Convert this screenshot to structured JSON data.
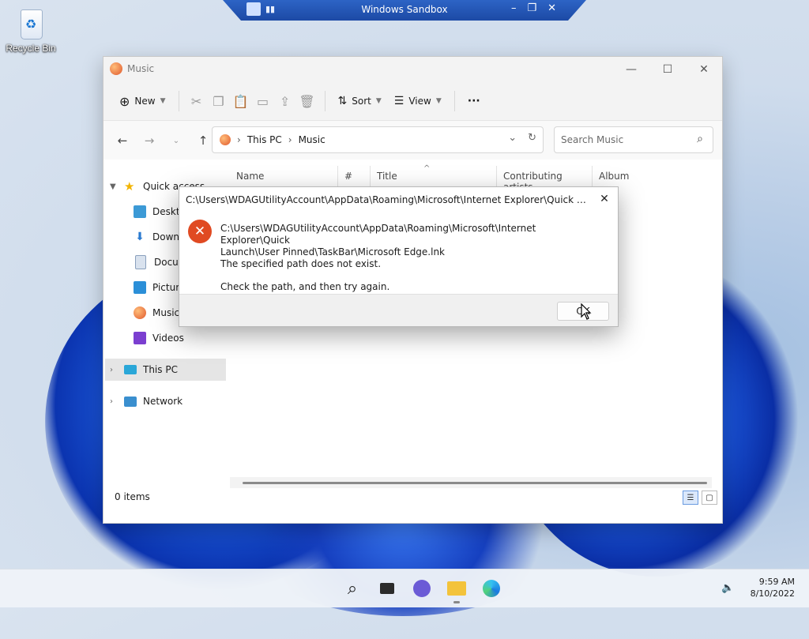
{
  "desktop": {
    "recycle_bin_label": "Recycle Bin"
  },
  "sandbox": {
    "title": "Windows Sandbox"
  },
  "explorer": {
    "title": "Music",
    "toolbar": {
      "new_label": "New",
      "sort_label": "Sort",
      "view_label": "View",
      "more_label": "···"
    },
    "address": {
      "crumbs": [
        "This PC",
        "Music"
      ]
    },
    "search_placeholder": "Search Music",
    "columns": [
      "Name",
      "#",
      "Title",
      "Contributing artists",
      "Album"
    ],
    "sidebar": {
      "quick_access": "Quick access",
      "items": [
        "Desktop",
        "Downloads",
        "Documents",
        "Pictures",
        "Music",
        "Videos"
      ],
      "this_pc": "This PC",
      "network": "Network"
    },
    "status_count": "0 items"
  },
  "dialog": {
    "title": "C:\\Users\\WDAGUtilityAccount\\AppData\\Roaming\\Microsoft\\Internet Explorer\\Quick Launch\\U...",
    "line1": "C:\\Users\\WDAGUtilityAccount\\AppData\\Roaming\\Microsoft\\Internet Explorer\\Quick",
    "line2": "Launch\\User Pinned\\TaskBar\\Microsoft Edge.lnk",
    "line3": "The specified path does not exist.",
    "line4": "Check the path, and then try again.",
    "ok_label": "OK"
  },
  "taskbar": {
    "time": "9:59 AM",
    "date": "8/10/2022"
  },
  "colors": {
    "accent": "#1b7ae0",
    "error": "#e04a22"
  }
}
